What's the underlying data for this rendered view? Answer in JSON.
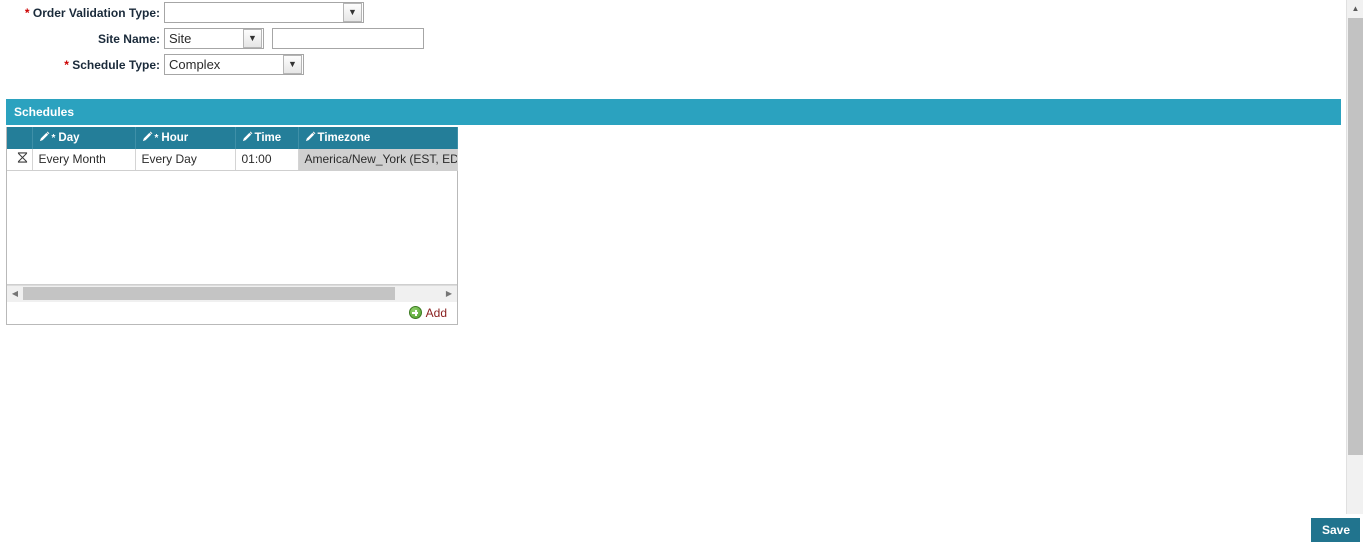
{
  "form": {
    "fields": [
      {
        "label": "Order Validation Type:",
        "required": true,
        "control": "select",
        "value": "",
        "icon": "chevron-down-icon",
        "name": "order-validation-type"
      },
      {
        "label": "Site Name:",
        "required": false,
        "control": "select-with-text",
        "value": "Site",
        "text_value": "",
        "text_placeholder": "",
        "icon": "chevron-down-icon",
        "name": "site-name"
      },
      {
        "label": "Schedule Type:",
        "required": true,
        "control": "select",
        "value": "Complex",
        "icon": "chevron-down-icon",
        "name": "schedule-type"
      }
    ]
  },
  "panel": {
    "title": "Schedules",
    "title_bar_color": "#2ba2bf",
    "header_row_color": "#247e99"
  },
  "grid": {
    "columns": [
      {
        "label": "",
        "name": "row-handle",
        "editable": false,
        "required": false
      },
      {
        "label": "Day",
        "name": "day",
        "editable": true,
        "required": true
      },
      {
        "label": "Hour",
        "name": "hour",
        "editable": true,
        "required": true
      },
      {
        "label": "Time",
        "name": "time",
        "editable": true,
        "required": false
      },
      {
        "label": "Timezone",
        "name": "timezone",
        "editable": true,
        "required": false
      }
    ],
    "rows": [
      {
        "handle_icon": "drag-handle-icon",
        "day": "Every Month",
        "hour": "Every Day",
        "time": "01:00",
        "timezone": "America/New_York (EST, EDT)",
        "selected_cell": "timezone"
      }
    ],
    "add_label": "Add",
    "add_icon": "add-circle-icon",
    "scroll_left_icon": "triangle-left-icon",
    "scroll_right_icon": "triangle-right-icon"
  },
  "scrollbars": {
    "vertical": {
      "up_icon": "triangle-up-icon",
      "down_icon": "triangle-down-icon"
    },
    "horizontal": {
      "left_icon": "triangle-left-icon",
      "right_icon": "triangle-right-icon"
    }
  },
  "footer": {
    "save_label": "Save",
    "save_color": "#21748e"
  }
}
